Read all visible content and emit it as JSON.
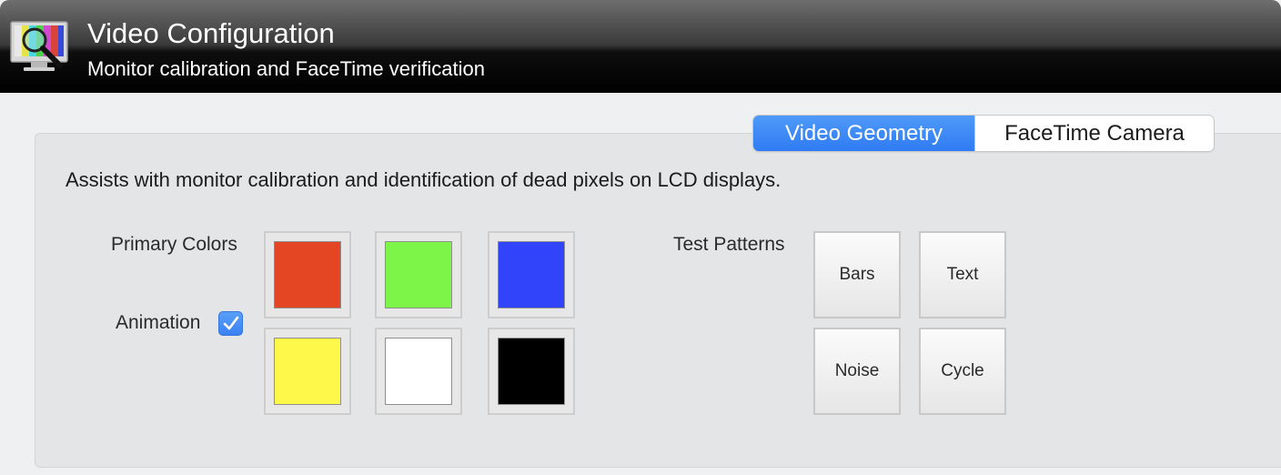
{
  "header": {
    "title": "Video Configuration",
    "subtitle": "Monitor calibration and FaceTime verification",
    "icon": "monitor-magnifier-icon"
  },
  "tabs": [
    {
      "label": "Video Geometry",
      "active": true
    },
    {
      "label": "FaceTime Camera",
      "active": false
    }
  ],
  "description": "Assists with monitor calibration and identification of dead pixels on LCD displays.",
  "primary_colors": {
    "label": "Primary Colors",
    "swatches": [
      {
        "name": "red",
        "color": "#e44624"
      },
      {
        "name": "green",
        "color": "#7df448"
      },
      {
        "name": "blue",
        "color": "#3244f9"
      },
      {
        "name": "yellow",
        "color": "#fdf84a"
      },
      {
        "name": "white",
        "color": "#ffffff"
      },
      {
        "name": "black",
        "color": "#000000"
      }
    ]
  },
  "animation": {
    "label": "Animation",
    "checked": true
  },
  "test_patterns": {
    "label": "Test Patterns",
    "buttons": [
      "Bars",
      "Text",
      "Noise",
      "Cycle"
    ]
  },
  "colors": {
    "accent": "#3a82f3"
  }
}
